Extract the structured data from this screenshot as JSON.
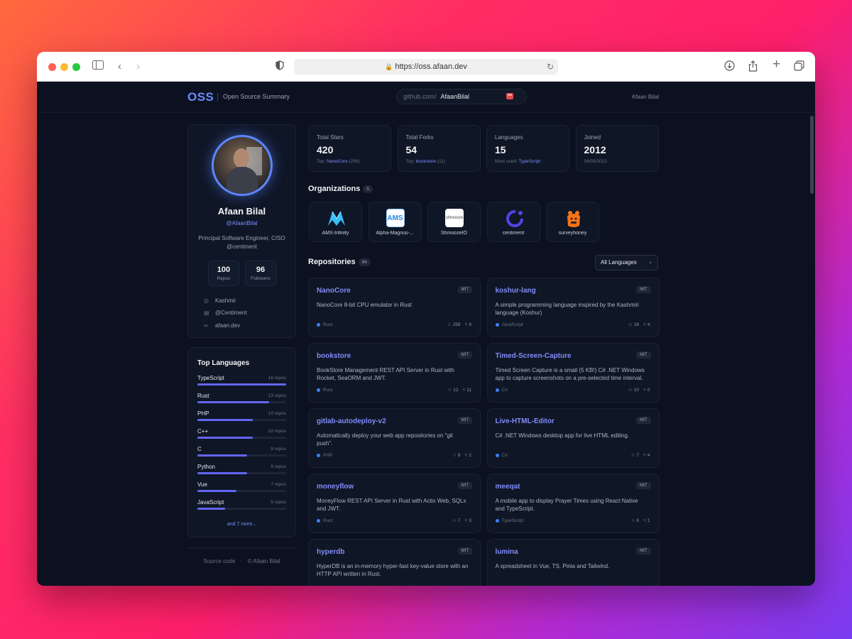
{
  "browser": {
    "url": "https://oss.afaan.dev"
  },
  "nav": {
    "logo": "OSS",
    "subtitle": "Open Source Summary",
    "gh_prefix": "github.com/",
    "gh_user": "AfaanBilal",
    "gh_button": "•••",
    "user": "Afaan Bilal"
  },
  "profile": {
    "name": "Afaan Bilal",
    "handle": "@AfaanBilal",
    "bio": "Principal Software Engineer, CISO @centiment",
    "repos": {
      "value": "100",
      "label": "Repos"
    },
    "followers": {
      "value": "96",
      "label": "Followers"
    },
    "location": "Kashmir",
    "company": "@Centiment",
    "website": "afaan.dev"
  },
  "stats": [
    {
      "label": "Total Stars",
      "value": "420",
      "sub_prefix": "Top:",
      "sub_highlight": "NanoCore",
      "sub_suffix": "(258)"
    },
    {
      "label": "Total Forks",
      "value": "54",
      "sub_prefix": "Top:",
      "sub_highlight": "bookstore",
      "sub_suffix": "(11)"
    },
    {
      "label": "Languages",
      "value": "15",
      "sub_prefix": "Most used:",
      "sub_highlight": "TypeScript",
      "sub_suffix": ""
    },
    {
      "label": "Joined",
      "value": "2012",
      "sub_prefix": "06/03/2012",
      "sub_highlight": "",
      "sub_suffix": ""
    }
  ],
  "organizations": {
    "title": "Organizations",
    "count": "5",
    "items": [
      {
        "name": "AMX-Infinity",
        "icon": "amx-logo"
      },
      {
        "name": "Alpha-Magnus-...",
        "icon": "ams-logo",
        "logo_text": "AMS"
      },
      {
        "name": "ShmoozeIO",
        "icon": "shmooze-logo",
        "logo_text": "shmooze"
      },
      {
        "name": "centiment",
        "icon": "centiment-logo"
      },
      {
        "name": "surveyhoney",
        "icon": "surveyhoney-logo"
      }
    ]
  },
  "languages": {
    "title": "Top Languages",
    "items": [
      {
        "name": "TypeScript",
        "count": "16 repos",
        "share": 1.0
      },
      {
        "name": "Rust",
        "count": "13 repos",
        "share": 0.81
      },
      {
        "name": "PHP",
        "count": "10 repos",
        "share": 0.62
      },
      {
        "name": "C++",
        "count": "10 repos",
        "share": 0.62
      },
      {
        "name": "C",
        "count": "9 repos",
        "share": 0.56
      },
      {
        "name": "Python",
        "count": "9 repos",
        "share": 0.56
      },
      {
        "name": "Vue",
        "count": "7 repos",
        "share": 0.44
      },
      {
        "name": "JavaScript",
        "count": "5 repos",
        "share": 0.31
      }
    ],
    "more": "and 7 more..."
  },
  "footer": {
    "source": "Source code",
    "sep": "·",
    "copy": "© Afaan Bilal"
  },
  "repositories": {
    "title": "Repositories",
    "count": "94",
    "filter": "All Languages",
    "items": [
      {
        "name": "NanoCore",
        "license": "MIT",
        "desc": "NanoCore 8-bit CPU emulator in Rust",
        "lang": "Rust",
        "stars": "258",
        "forks": "9"
      },
      {
        "name": "koshur-lang",
        "license": "MIT",
        "desc": "A simple programming language inspired by the Kashmiri language (Koshur)",
        "lang": "JavaScript",
        "stars": "26",
        "forks": "4"
      },
      {
        "name": "bookstore",
        "license": "MIT",
        "desc": "BookStore Management REST API Server in Rust with Rocket, SeaORM and JWT.",
        "lang": "Rust",
        "stars": "12",
        "forks": "11"
      },
      {
        "name": "Timed-Screen-Capture",
        "license": "MIT",
        "desc": "Timed Screen Capture is a small (5 KB!) C# .NET Windows app to capture screenshots on a pre-selected time interval.",
        "lang": "C#",
        "stars": "10",
        "forks": "0"
      },
      {
        "name": "gitlab-autodeploy-v2",
        "license": "MIT",
        "desc": "Automatically deploy your web app repositories on \"git push\".",
        "lang": "PHP",
        "stars": "8",
        "forks": "2"
      },
      {
        "name": "Live-HTML-Editor",
        "license": "MIT",
        "desc": "C# .NET Windows desktop app for live HTML editing.",
        "lang": "C#",
        "stars": "7",
        "forks": "4"
      },
      {
        "name": "moneyflow",
        "license": "MIT",
        "desc": "MoneyFlow REST API Server in Rust with Actix Web, SQLx and JWT.",
        "lang": "Rust",
        "stars": "7",
        "forks": "3"
      },
      {
        "name": "meeqat",
        "license": "MIT",
        "desc": "A mobile app to display Prayer Times using React Native and TypeScript.",
        "lang": "TypeScript",
        "stars": "6",
        "forks": "1"
      },
      {
        "name": "hyperdb",
        "license": "MIT",
        "desc": "HyperDB is an in-memory hyper-fast key-value store with an HTTP API written in Rust.",
        "lang": "",
        "stars": "",
        "forks": ""
      },
      {
        "name": "lumina",
        "license": "MIT",
        "desc": "A spreadsheet in Vue, TS, Pinia and Tailwind.",
        "lang": "",
        "stars": "",
        "forks": ""
      }
    ]
  },
  "colors": {
    "accent": "#6366f1",
    "link": "#818cf8",
    "lang_dot": "#3b82f6"
  }
}
